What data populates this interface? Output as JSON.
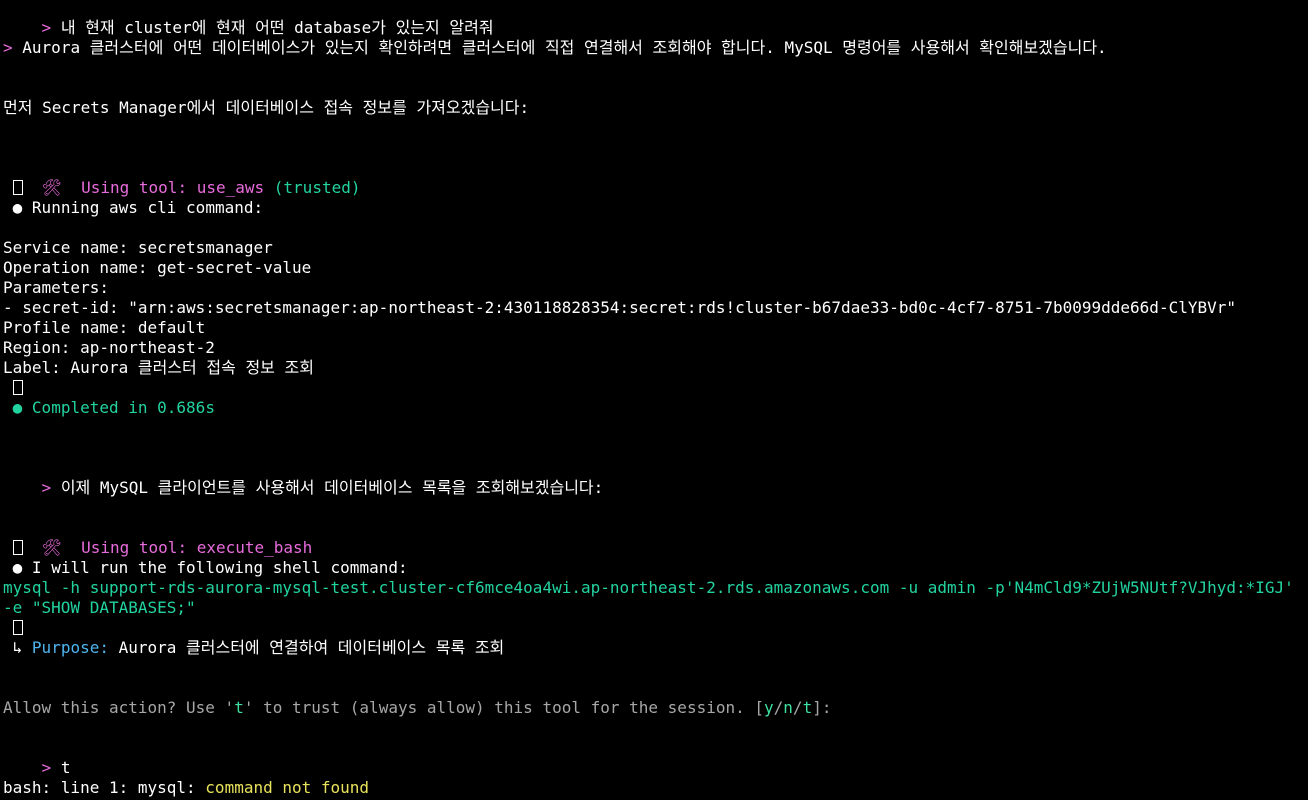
{
  "terminal": {
    "prompt_symbol": ">",
    "lines": {
      "l1": "내 현재 cluster에 현재 어떤 database가 있는지 알려줘",
      "l2": "Aurora 클러스터에 어떤 데이터베이스가 있는지 확인하려면 클러스터에 직접 연결해서 조회해야 합니다. MySQL 명령어를 사용해서 확인해보겠습니다.",
      "l3": "먼저 Secrets Manager에서 데이터베이스 접속 정보를 가져오겠습니다:",
      "tool1_icon": "🛠️",
      "tool1_prefix": "Using tool: ",
      "tool1_name": "use_aws",
      "tool1_trusted": "(trusted)",
      "running_bullet": "●",
      "running_text": "Running aws cli command:",
      "service": "Service name: secretsmanager",
      "operation": "Operation name: get-secret-value",
      "parameters": "Parameters:",
      "secret_id": "- secret-id: \"arn:aws:secretsmanager:ap-northeast-2:430118828354:secret:rds!cluster-b67dae33-bd0c-4cf7-8751-7b0099dde66d-ClYBVr\"",
      "profile": "Profile name: default",
      "region": "Region: ap-northeast-2",
      "label": "Label: Aurora 클러스터 접속 정보 조회",
      "completed_bullet": "●",
      "completed": "Completed in 0.686s",
      "l4": "이제 MySQL 클라이언트를 사용해서 데이터베이스 목록을 조회해보겠습니다:",
      "tool2_icon": "🛠️",
      "tool2_prefix": "Using tool: ",
      "tool2_name": "execute_bash",
      "will_run_bullet": "●",
      "will_run": "I will run the following shell command:",
      "command": "mysql -h support-rds-aurora-mysql-test.cluster-cf6mce4oa4wi.ap-northeast-2.rds.amazonaws.com -u admin -p'N4mCld9*ZUjW5NUtf?VJhyd:*IGJ' -e \"SHOW DATABASES;\"",
      "purpose_arrow": "↳",
      "purpose_label": "Purpose:",
      "purpose_text": "Aurora 클러스터에 연결하여 데이터베이스 목록 조회",
      "allow_prefix": "Allow this action? Use '",
      "allow_t": "t",
      "allow_mid": "' to trust (always allow) this tool for the session. [",
      "allow_y": "y",
      "allow_slash1": "/",
      "allow_n": "n",
      "allow_slash2": "/",
      "allow_t2": "t",
      "allow_end": "]:",
      "user_reply": "t",
      "bash_prefix": "bash: line 1: mysql: ",
      "bash_error": "command not found"
    }
  },
  "colors": {
    "background": "#000000",
    "tool_pink": "#e86bdc",
    "success_teal": "#22d3a0",
    "purpose_blue": "#4fb4ee",
    "prompt_gray": "#a7a7a7",
    "error_yellow": "#e8e35a"
  }
}
